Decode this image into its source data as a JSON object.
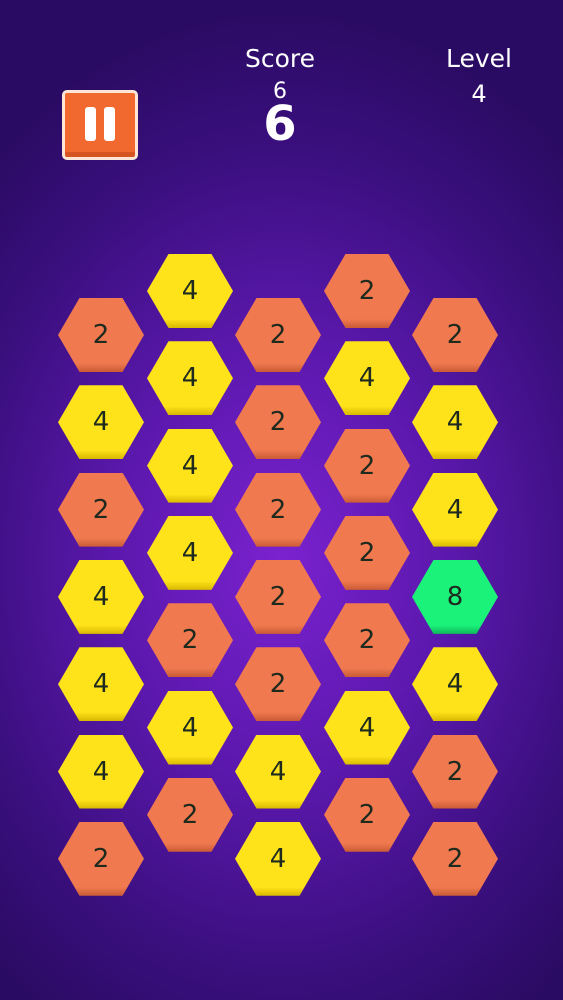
{
  "header": {
    "score_label": "Score",
    "score_small": "6",
    "score_value": "6",
    "level_label": "Level",
    "level_value": "4"
  },
  "colors": {
    "tile_2": "#f0794f",
    "tile_2_edge": "#c95a35",
    "tile_4": "#ffe31a",
    "tile_4_edge": "#d8b800",
    "tile_8": "#1bf27a",
    "tile_8_edge": "#0fb85a",
    "pause_button": "#f2692f"
  },
  "board": {
    "columns": [
      [
        "2",
        "4",
        "2",
        "4",
        "4",
        "4",
        "2"
      ],
      [
        "4",
        "4",
        "4",
        "4",
        "2",
        "4",
        "2"
      ],
      [
        "2",
        "2",
        "2",
        "2",
        "2",
        "4",
        "4"
      ],
      [
        "2",
        "4",
        "2",
        "2",
        "2",
        "4",
        "2"
      ],
      [
        "2",
        "4",
        "4",
        "8",
        "4",
        "2",
        "2"
      ]
    ]
  }
}
